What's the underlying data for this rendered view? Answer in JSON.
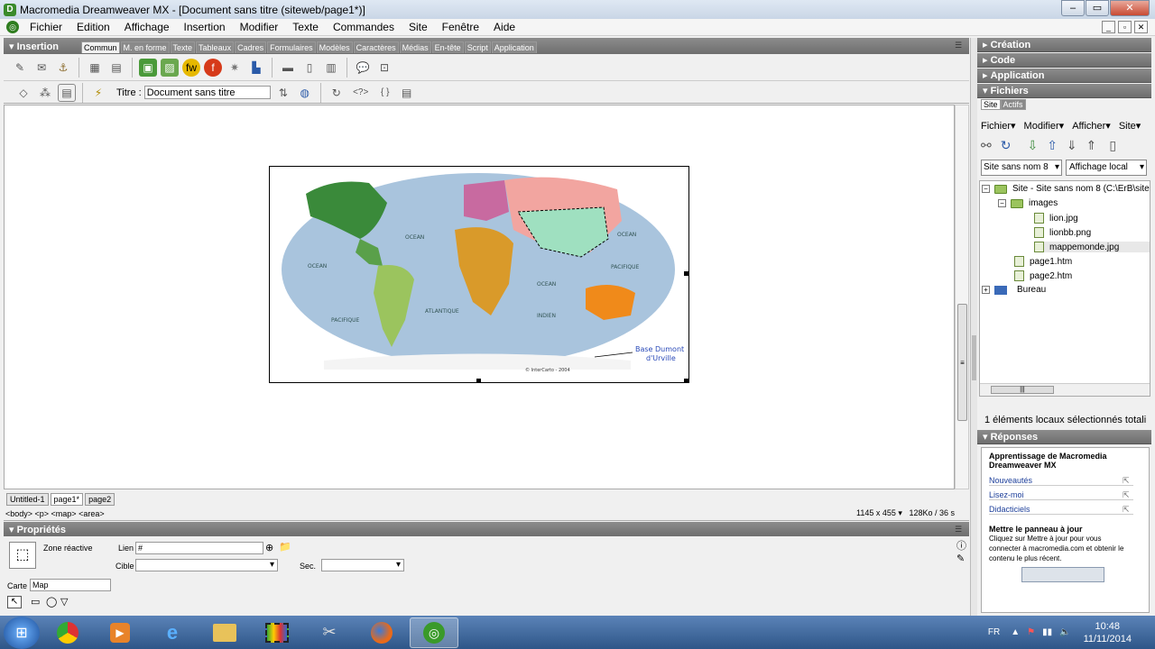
{
  "window": {
    "title": "Macromedia Dreamweaver MX - [Document sans titre (siteweb/page1*)]"
  },
  "menu": [
    "Fichier",
    "Edition",
    "Affichage",
    "Insertion",
    "Modifier",
    "Texte",
    "Commandes",
    "Site",
    "Fenêtre",
    "Aide"
  ],
  "insertion": {
    "label": "Insertion",
    "tabs": [
      "Commun",
      "M. en forme",
      "Texte",
      "Tableaux",
      "Cadres",
      "Formulaires",
      "Modèles",
      "Caractères",
      "Médias",
      "En-tête",
      "Script",
      "Application"
    ],
    "active_tab": "Commun"
  },
  "doc_toolbar": {
    "title_label": "Titre :",
    "title_value": "Document sans titre"
  },
  "map": {
    "labels": [
      "OCEAN",
      "OCEAN",
      "OCEAN",
      "PACIFIQUE",
      "ATLANTIQUE",
      "OCEAN",
      "INDIEN",
      "PACIFIQUE"
    ],
    "annotation_1": "Base Dumont",
    "annotation_2": "d'Urville",
    "copyright": "© InterCarto - 2004"
  },
  "doc_tabs": [
    "Untitled-1",
    "page1*",
    "page2"
  ],
  "status": {
    "tags": "<body> <p> <map> <area>",
    "size": "1145 x 455",
    "weight": "128Ko / 36 s"
  },
  "properties": {
    "header": "Propriétés",
    "zone_label": "Zone réactive",
    "lien_label": "Lien",
    "lien_value": "#",
    "cible_label": "Cible",
    "sec_label": "Sec.",
    "carte_label": "Carte",
    "carte_value": "Map"
  },
  "right_panels": {
    "creation": "Création",
    "code": "Code",
    "application": "Application",
    "fichiers": "Fichiers",
    "site_tabs": [
      "Site",
      "Actifs"
    ],
    "site_menu": [
      "Fichier",
      "Modifier",
      "Afficher",
      "Site"
    ],
    "site_select": "Site sans nom 8",
    "view_select": "Affichage local",
    "tree": [
      {
        "label": "Site - Site sans nom 8 (C:\\ErB\\site",
        "type": "root"
      },
      {
        "label": "images",
        "type": "folder"
      },
      {
        "label": "lion.jpg",
        "type": "file"
      },
      {
        "label": "lionbb.png",
        "type": "file"
      },
      {
        "label": "mappemonde.jpg",
        "type": "file"
      },
      {
        "label": "page1.htm",
        "type": "file"
      },
      {
        "label": "page2.htm",
        "type": "file"
      },
      {
        "label": "Bureau",
        "type": "desktop"
      }
    ],
    "files_status": "1 éléments locaux sélectionnés totali",
    "reponses": "Réponses",
    "answers_title_1": "Apprentissage de Macromedia",
    "answers_title_2": "Dreamweaver MX",
    "answers_links": [
      "Nouveautés",
      "Lisez-moi",
      "Didacticiels"
    ],
    "update_title": "Mettre le panneau à jour",
    "update_text": [
      "Cliquez sur Mettre à jour pour vous",
      "connecter à macromedia.com et obtenir le",
      "contenu le plus récent."
    ]
  },
  "taskbar": {
    "lang": "FR",
    "time": "10:48",
    "date": "11/11/2014"
  }
}
